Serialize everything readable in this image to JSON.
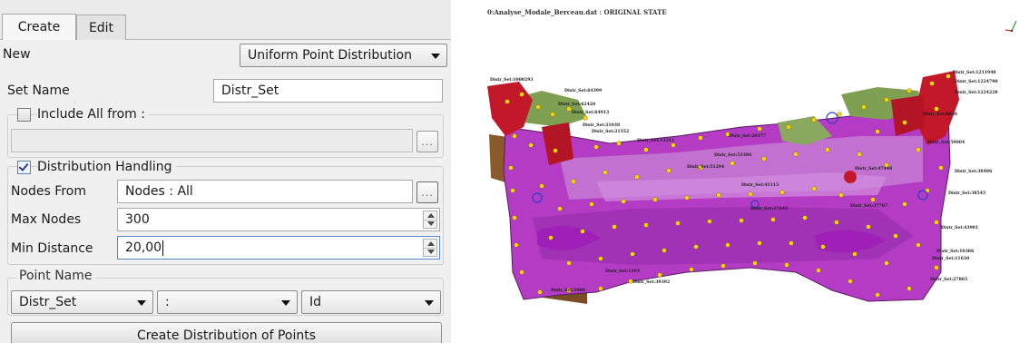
{
  "tabs": {
    "create": "Create",
    "edit": "Edit"
  },
  "form": {
    "new_label": "New",
    "new_value": "Uniform Point Distribution",
    "set_name_label": "Set Name",
    "set_name_value": "Distr_Set",
    "include_label": "Include All from :",
    "include_checked": false,
    "include_value": "",
    "ellipsis": "...",
    "distribution_label": "Distribution Handling",
    "distribution_checked": true,
    "nodes_from_label": "Nodes From",
    "nodes_from_value": "Nodes : All",
    "max_nodes_label": "Max Nodes",
    "max_nodes_value": "300",
    "min_distance_label": "Min Distance",
    "min_distance_value": "20,00",
    "point_name_label": "Point Name",
    "point_name_prefix": "Distr_Set",
    "point_name_separator": ":",
    "point_name_suffix": "Id",
    "create_button": "Create Distribution of Points"
  },
  "viewport": {
    "title": "0:Analyse_Modale_Berceau.dat  : ORIGINAL STATE",
    "axis_x_icon": "triad-x",
    "axis_y_icon": "triad-y",
    "labels": {
      "l1": "Distr_Set:1000293",
      "l2": "Distr_Set:1211948",
      "l3": "Distr_Set:1224790",
      "l4": "Distr_Set:1224228",
      "l5": "Distr_Set:64399",
      "l6": "Distr_Set:64913",
      "l7": "Distr_Set:62420",
      "l8": "Distr_Set:21038",
      "l9": "Distr_Set:21552",
      "l10": "Distr_Set:20377",
      "l11": "Distr_Set:12211",
      "l12": "Distr_Set:38496",
      "l13": "Distr_Set:38545",
      "l14": "Distr_Set:47448",
      "l15": "Distr_Set:53396",
      "l16": "Distr_Set:51294",
      "l17": "Distr_Set:41113",
      "l18": "Distr_Set:37767",
      "l19": "Distr_Set:27640",
      "l20": "Distr_Set:39392",
      "l21": "Distr_Set:27865",
      "l22": "Distr_Set:10386",
      "l23": "Distr_Set:11630",
      "l24": "Distr_Set:43981",
      "l25": "Distr_Set:1393",
      "l26": "Distr_Set:5906",
      "l27": "Distr_Set:8020",
      "l28": "Distr_Set:59004"
    },
    "colors": {
      "purple": "#b43cc4",
      "light_purple": "#c57ad2",
      "red": "#c2182a",
      "green": "#7fa052",
      "brown": "#8a5a2b",
      "yellow_node": "#f2d700"
    }
  }
}
